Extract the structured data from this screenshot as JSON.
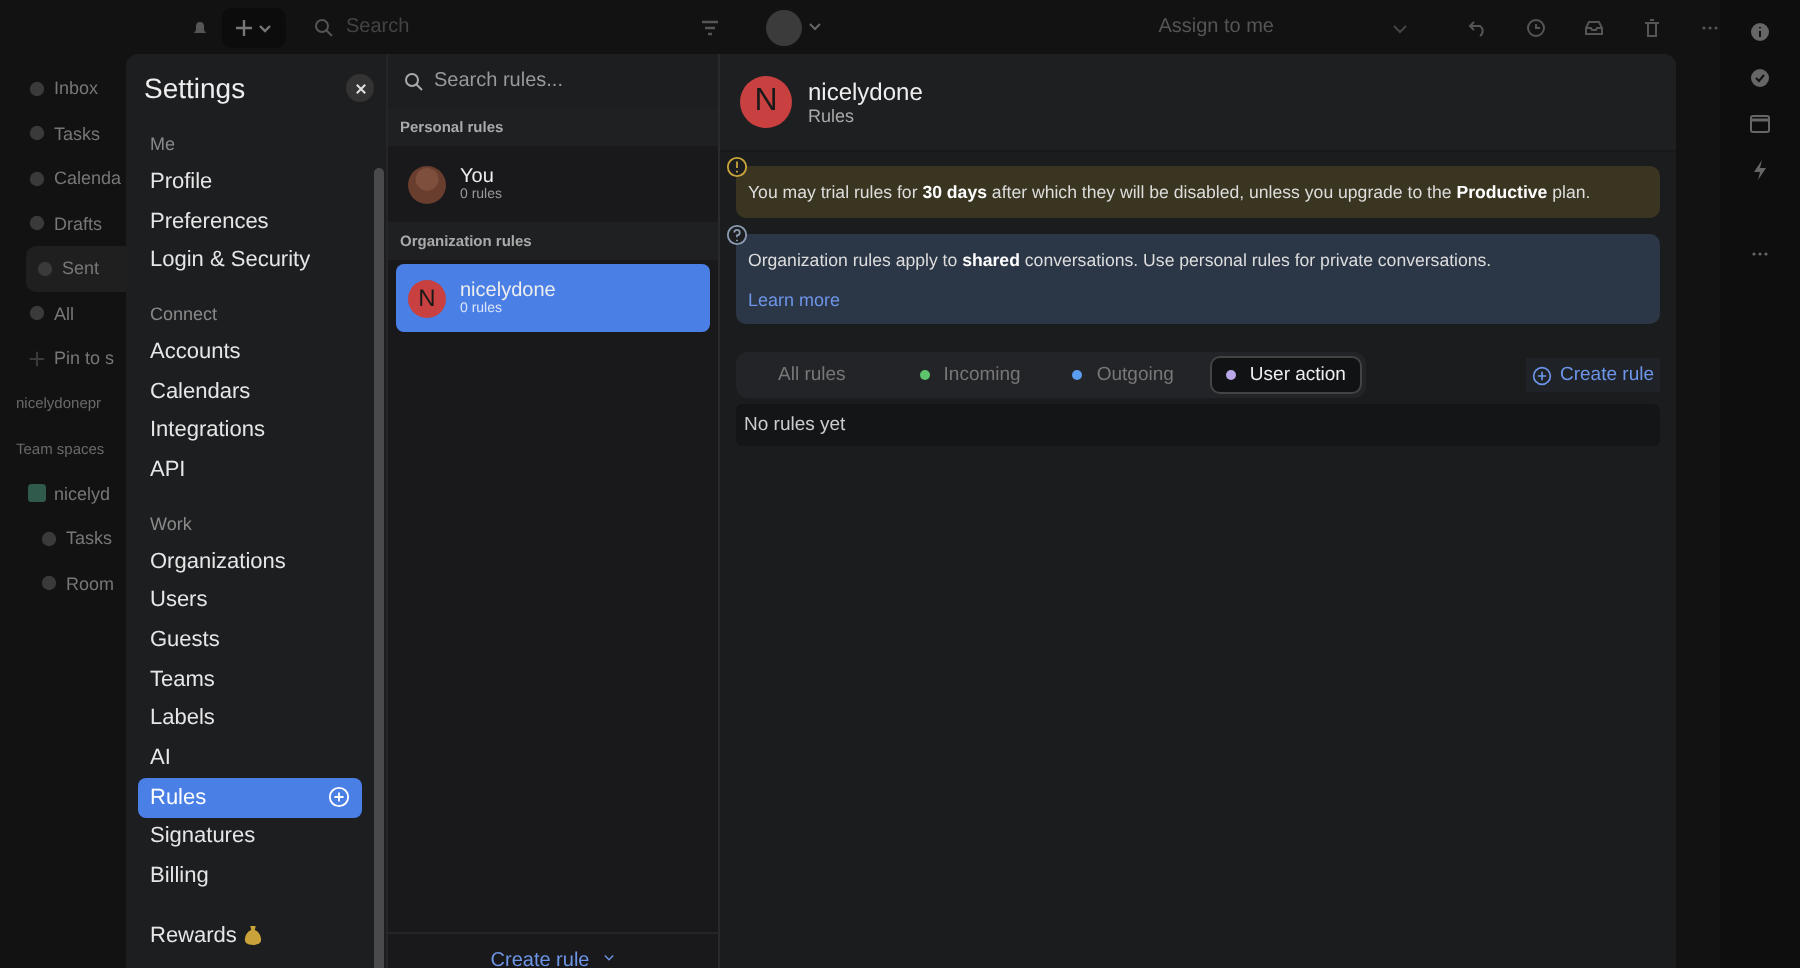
{
  "topbar": {
    "search_placeholder": "Search",
    "assign": "Assign to me"
  },
  "sidebar": [
    {
      "kind": "item",
      "label": "Inbox",
      "selected": false
    },
    {
      "kind": "item",
      "label": "Tasks",
      "selected": false
    },
    {
      "kind": "item",
      "label": "Calenda",
      "selected": false
    },
    {
      "kind": "item",
      "label": "Drafts",
      "selected": false
    },
    {
      "kind": "item",
      "label": "Sent",
      "selected": true
    },
    {
      "kind": "item",
      "label": "All",
      "selected": false
    },
    {
      "kind": "add",
      "label": "Pin to s",
      "selected": false
    },
    {
      "kind": "heading",
      "label": "nicelydonepr",
      "selected": false
    },
    {
      "kind": "heading",
      "label": "Team spaces",
      "selected": false
    },
    {
      "kind": "team",
      "label": "nicelyd",
      "selected": false
    },
    {
      "kind": "sub",
      "label": "Tasks",
      "selected": false
    },
    {
      "kind": "sub",
      "label": "Room",
      "selected": false
    }
  ],
  "settings": {
    "title": "Settings",
    "groups": [
      {
        "heading": "Me",
        "items": [
          {
            "label": "Profile",
            "selected": false
          },
          {
            "label": "Preferences",
            "selected": false
          },
          {
            "label": "Login & Security",
            "selected": false
          }
        ]
      },
      {
        "heading": "Connect",
        "items": [
          {
            "label": "Accounts",
            "selected": false
          },
          {
            "label": "Calendars",
            "selected": false
          },
          {
            "label": "Integrations",
            "selected": false
          },
          {
            "label": "API",
            "selected": false
          }
        ]
      },
      {
        "heading": "Work",
        "items": [
          {
            "label": "Organizations",
            "selected": false
          },
          {
            "label": "Users",
            "selected": false
          },
          {
            "label": "Guests",
            "selected": false
          },
          {
            "label": "Teams",
            "selected": false
          },
          {
            "label": "Labels",
            "selected": false
          },
          {
            "label": "AI",
            "selected": false
          },
          {
            "label": "Rules",
            "selected": true
          },
          {
            "label": "Signatures",
            "selected": false
          },
          {
            "label": "Billing",
            "selected": false
          }
        ]
      },
      {
        "items": [
          {
            "label": "Rewards",
            "selected": false
          }
        ]
      }
    ]
  },
  "rules_list": {
    "search_placeholder": "Search rules...",
    "sections": [
      {
        "heading": "Personal rules",
        "items": [
          {
            "name": "You",
            "count": "0 rules",
            "kind": "photo",
            "selected": false
          }
        ]
      },
      {
        "heading": "Organization rules",
        "items": [
          {
            "name": "nicelydone",
            "count": "0 rules",
            "kind": "letter",
            "initial": "N",
            "selected": true
          }
        ]
      }
    ],
    "footer": "Create rule"
  },
  "detail": {
    "initial": "N",
    "title": "nicelydone",
    "subtitle": "Rules",
    "notices": [
      {
        "kind": "warning",
        "text": "You may trial rules for **30 days** after which they will be disabled, unless you upgrade to the **Productive** plan."
      },
      {
        "kind": "info",
        "text": "Organization rules apply to **shared** conversations. Use personal rules for private conversations.",
        "link": "Learn more"
      }
    ],
    "filters": [
      {
        "label": "All rules",
        "selected": false
      },
      {
        "label": "Incoming",
        "color": "#5cc46a",
        "selected": false
      },
      {
        "label": "Outgoing",
        "color": "#5a9cf0",
        "selected": false
      },
      {
        "label": "User action",
        "color": "#b9a8e8",
        "selected": true
      }
    ],
    "create": "Create rule",
    "empty": "No rules yet"
  }
}
